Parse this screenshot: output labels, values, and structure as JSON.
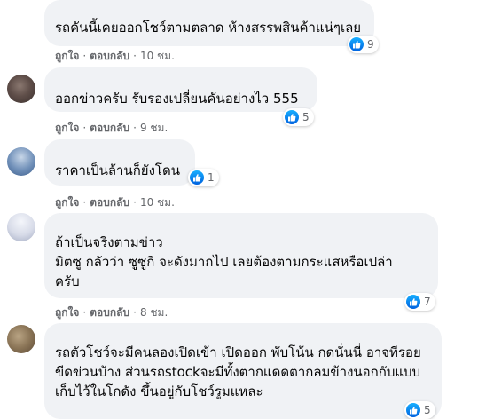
{
  "colors": {
    "bubble_bg": "#f0f2f5",
    "text": "#050505",
    "meta": "#65676b",
    "like_blue": "#1877f2"
  },
  "comments": [
    {
      "author": "",
      "text": "รถคันนี้เคยออกโชว์ตามตลาด ห้างสรรพสินค้าแน่ๆเลย",
      "reaction_icon": "like-icon",
      "reaction_count": "9",
      "like_label": "ถูกใจ",
      "reply_label": "ตอบกลับ",
      "time": "10 ชม."
    },
    {
      "author": "",
      "text": "ออกข่าวครับ รับรองเปลี่ยนคันอย่างไว 555",
      "reaction_icon": "like-icon",
      "reaction_count": "5",
      "like_label": "ถูกใจ",
      "reply_label": "ตอบกลับ",
      "time": "9 ชม."
    },
    {
      "author": "",
      "text": "ราคาเป็นล้านก็ยังโดน",
      "reaction_icon": "like-icon",
      "reaction_count": "1",
      "like_label": "ถูกใจ",
      "reply_label": "ตอบกลับ",
      "time": "10 ชม."
    },
    {
      "author": "",
      "text": "ถ้าเป็นจริงตามข่าว\nมิตซู กลัวว่า ซูซูกิ จะดังมากไป เลยต้องตามกระแสหรือเปล่า\nครับ",
      "reaction_icon": "like-icon",
      "reaction_count": "7",
      "like_label": "ถูกใจ",
      "reply_label": "ตอบกลับ",
      "time": "8 ชม."
    },
    {
      "author": "",
      "text": "รถตัวโชว์จะมีคนลองเปิดเข้า เปิดออก พับโน้น กดนั่นนี่ อาจทีรอยขีดข่วนบ้าง ส่วนรถstockจะมีทั้งตากแดดตากลมข้างนอกกับแบบเก็บไว้ในโกดัง ขึ้นอยู่กับโชว์รูมแหละ",
      "reaction_icon": "like-icon",
      "reaction_count": "5",
      "like_label": "",
      "reply_label": "",
      "time": ""
    }
  ]
}
